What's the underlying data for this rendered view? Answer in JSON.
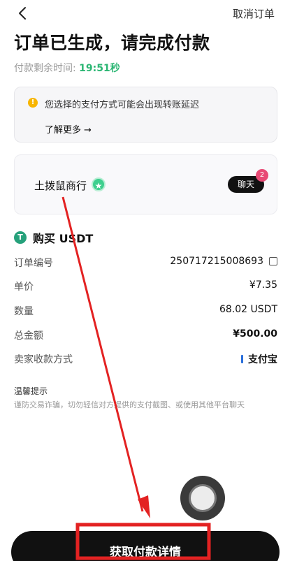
{
  "header": {
    "cancel_label": "取消订单",
    "title": "订单已生成，请完成付款",
    "timer_label": "付款剩余时间:",
    "timer_value": "19:51秒"
  },
  "notice": {
    "text": "您选择的支付方式可能会出现转账延迟",
    "learn_more": "了解更多",
    "learn_more_arrow": "→"
  },
  "merchant": {
    "name": "土拨鼠商行",
    "chat_label": "聊天",
    "chat_badge": "2"
  },
  "order": {
    "heading": "购买 USDT",
    "rows": [
      {
        "label": "订单编号",
        "value": "250717215008693"
      },
      {
        "label": "单价",
        "value": "¥7.35"
      },
      {
        "label": "数量",
        "value": "68.02 USDT"
      },
      {
        "label": "总金额",
        "value": "¥500.00"
      },
      {
        "label": "卖家收款方式",
        "value": "支付宝"
      }
    ]
  },
  "tips": {
    "title": "温馨提示",
    "body": "谨防交易诈骗，切勿轻信对方提供的支付截图、或使用其他平台聊天"
  },
  "cta": {
    "label": "获取付款详情"
  },
  "colors": {
    "accent_green": "#2bb673",
    "cta_bg": "#111111",
    "annotation_red": "#e32222",
    "tether_green": "#26a17b",
    "alipay_blue": "#2a6fdb"
  },
  "icons": [
    "back-chevron-icon",
    "warning-icon",
    "verified-icon",
    "usdt-icon",
    "copy-icon",
    "alipay-icon"
  ]
}
